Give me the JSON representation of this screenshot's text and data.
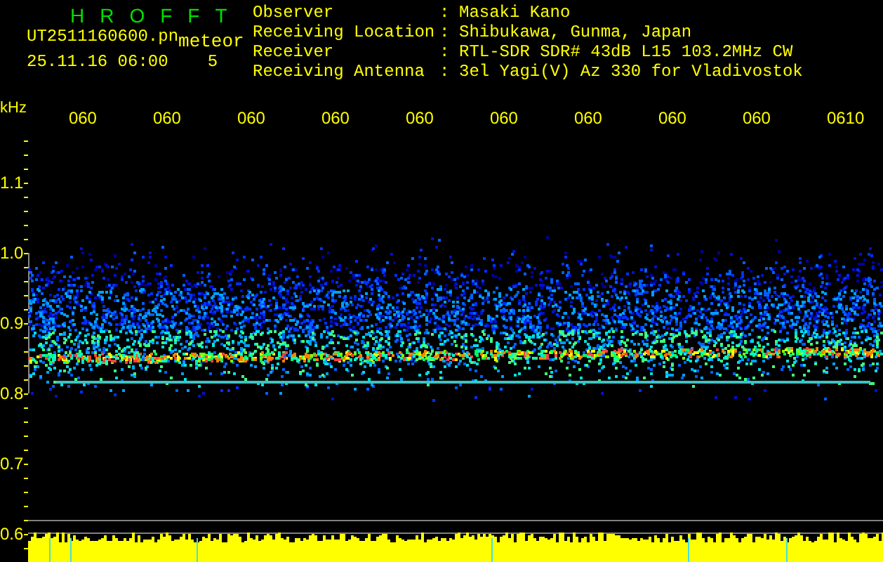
{
  "header": {
    "title": "HROFFT",
    "file": "UT2511160600.pn",
    "mode": "meteor",
    "datetime": "25.11.16 06:00",
    "count": "5"
  },
  "info": [
    {
      "label": "Observer",
      "separator": ":",
      "value": "Masaki Kano"
    },
    {
      "label": "Receiving Location",
      "separator": ":",
      "value": "Shibukawa, Gunma, Japan"
    },
    {
      "label": "Receiver",
      "separator": ":",
      "value": "RTL-SDR SDR# 43dB L15 103.2MHz CW"
    },
    {
      "label": "Receiving Antenna",
      "separator": ":",
      "value": "3el Yagi(V) Az 330 for Vladivostok"
    }
  ],
  "time_axis": {
    "labels": [
      "060",
      "060",
      "060",
      "060",
      "060",
      "060",
      "060",
      "060",
      "060",
      "0610"
    ]
  },
  "frequency_axis": {
    "unit": "kHz",
    "labels": [
      "1.1",
      "1.0",
      "0.9",
      "0.8",
      "0.7",
      "0.6"
    ]
  }
}
